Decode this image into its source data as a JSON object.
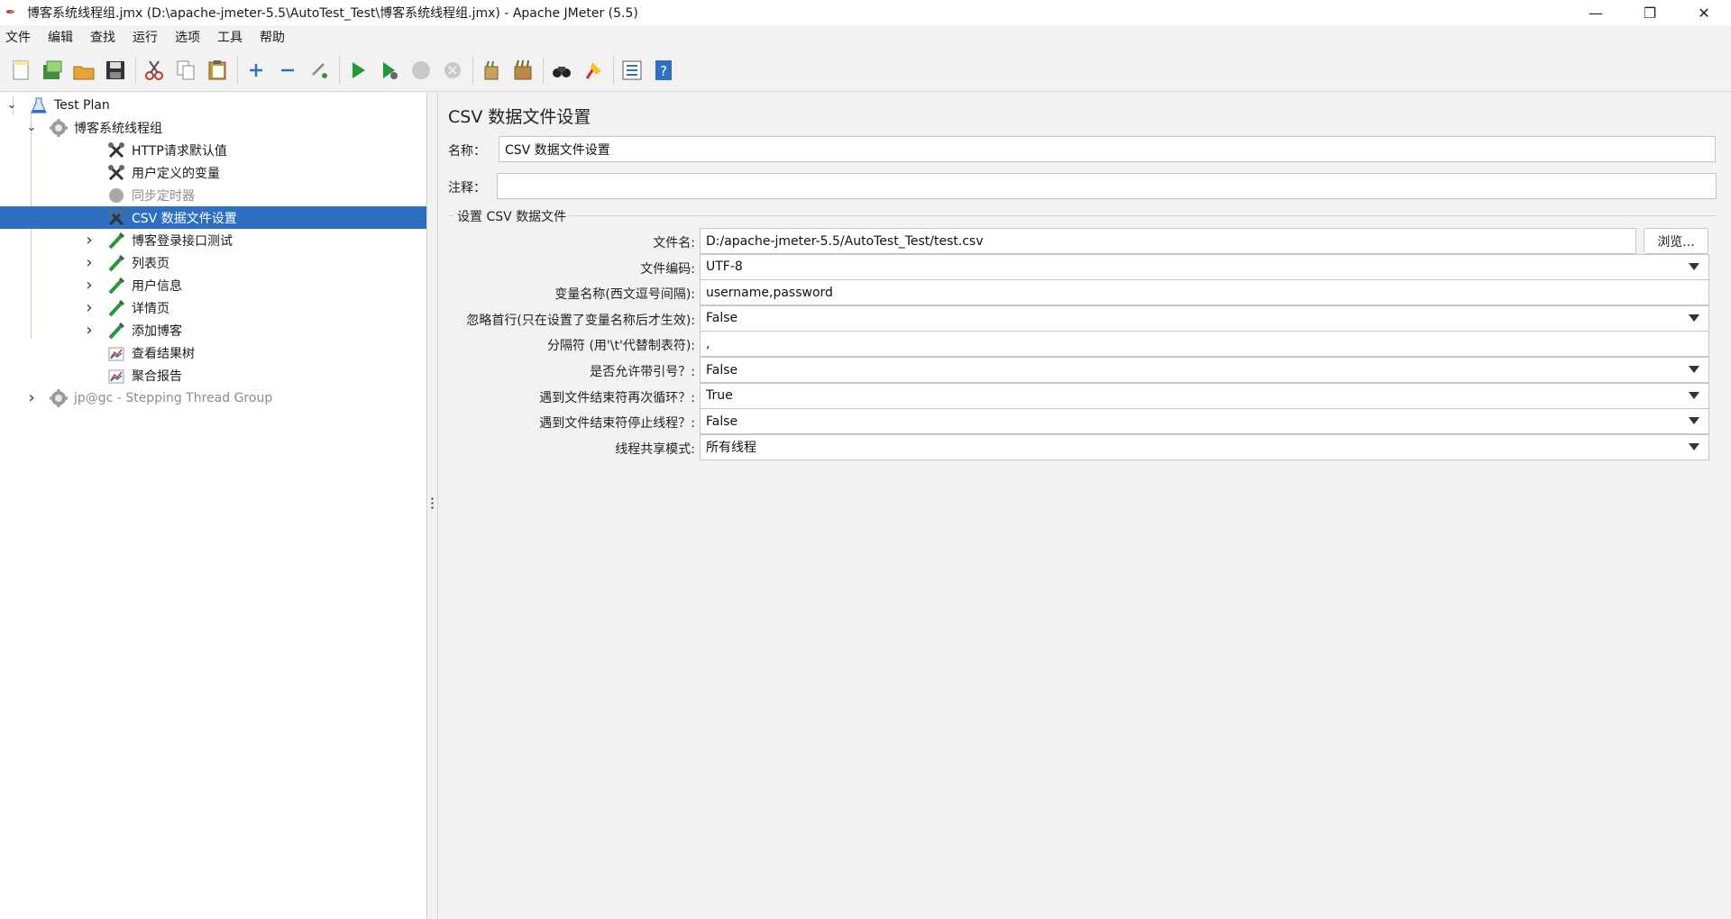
{
  "window": {
    "title": "博客系统线程组.jmx (D:\\apache-jmeter-5.5\\AutoTest_Test\\博客系统线程组.jmx) - Apache JMeter (5.5)",
    "controls": {
      "minimize": "—",
      "restore": "❐",
      "close": "✕"
    }
  },
  "menu": [
    "文件",
    "编辑",
    "查找",
    "运行",
    "选项",
    "工具",
    "帮助"
  ],
  "toolbar": [
    {
      "name": "new-icon"
    },
    {
      "name": "templates-icon"
    },
    {
      "name": "open-icon"
    },
    {
      "name": "save-icon"
    },
    {
      "name": "cut-icon"
    },
    {
      "name": "copy-icon"
    },
    {
      "name": "paste-icon"
    },
    {
      "name": "expand-icon"
    },
    {
      "name": "collapse-icon"
    },
    {
      "name": "toggle-icon"
    },
    {
      "name": "start-icon"
    },
    {
      "name": "start-no-pause-icon"
    },
    {
      "name": "stop-icon"
    },
    {
      "name": "shutdown-icon"
    },
    {
      "name": "clear-icon"
    },
    {
      "name": "clear-all-icon"
    },
    {
      "name": "search-icon"
    },
    {
      "name": "reset-search-icon"
    },
    {
      "name": "function-helper-icon"
    },
    {
      "name": "help-icon"
    }
  ],
  "tree": [
    {
      "label": "Test Plan",
      "icon": "test-plan-icon",
      "level": 0,
      "expander": "open"
    },
    {
      "label": "博客系统线程组",
      "icon": "thread-group-icon",
      "level": 1,
      "expander": "open"
    },
    {
      "label": "HTTP请求默认值",
      "icon": "config-icon",
      "level": 2,
      "expander": "none"
    },
    {
      "label": "用户定义的变量",
      "icon": "config-icon",
      "level": 2,
      "expander": "none"
    },
    {
      "label": "同步定时器",
      "icon": "timer-icon",
      "level": 2,
      "expander": "none",
      "disabled": true
    },
    {
      "label": "CSV 数据文件设置",
      "icon": "config-icon",
      "level": 2,
      "expander": "none",
      "selected": true
    },
    {
      "label": "博客登录接口测试",
      "icon": "sampler-icon",
      "level": 2,
      "expander": "closed"
    },
    {
      "label": "列表页",
      "icon": "sampler-icon",
      "level": 2,
      "expander": "closed"
    },
    {
      "label": "用户信息",
      "icon": "sampler-icon",
      "level": 2,
      "expander": "closed"
    },
    {
      "label": "详情页",
      "icon": "sampler-icon",
      "level": 2,
      "expander": "closed"
    },
    {
      "label": "添加博客",
      "icon": "sampler-icon",
      "level": 2,
      "expander": "closed"
    },
    {
      "label": "查看结果树",
      "icon": "listener-icon",
      "level": 2,
      "expander": "none"
    },
    {
      "label": "聚合报告",
      "icon": "listener-icon",
      "level": 2,
      "expander": "none"
    },
    {
      "label": "jp@gc - Stepping Thread Group",
      "icon": "thread-group-icon",
      "level": 1,
      "expander": "closed",
      "disabled": true
    }
  ],
  "panel": {
    "title": "CSV 数据文件设置",
    "name_label": "名称：",
    "name_value": "CSV 数据文件设置",
    "comment_label": "注释：",
    "comment_value": "",
    "group_title": "设置 CSV 数据文件",
    "browse_label": "浏览...",
    "fields": [
      {
        "label": "文件名:",
        "value": "D:/apache-jmeter-5.5/AutoTest_Test/test.csv",
        "type": "text"
      },
      {
        "label": "文件编码:",
        "value": "UTF-8",
        "type": "select"
      },
      {
        "label": "变量名称(西文逗号间隔):",
        "value": "username,password",
        "type": "text"
      },
      {
        "label": "忽略首行(只在设置了变量名称后才生效):",
        "value": "False",
        "type": "select"
      },
      {
        "label": "分隔符 (用'\\t'代替制表符):",
        "value": ",",
        "type": "text"
      },
      {
        "label": "是否允许带引号？:",
        "value": "False",
        "type": "select"
      },
      {
        "label": "遇到文件结束符再次循环？:",
        "value": "True",
        "type": "select"
      },
      {
        "label": "遇到文件结束符停止线程？:",
        "value": "False",
        "type": "select"
      },
      {
        "label": "线程共享模式:",
        "value": "所有线程",
        "type": "select"
      }
    ]
  }
}
